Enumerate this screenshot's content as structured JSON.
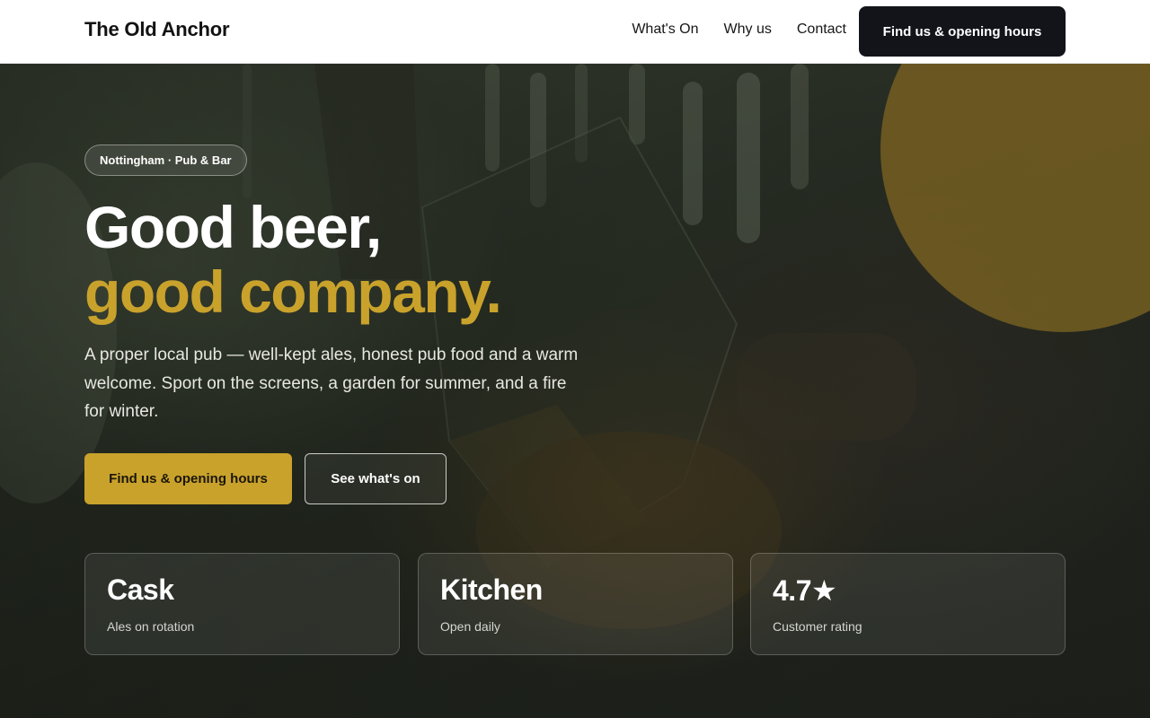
{
  "nav": {
    "brand": "The Old Anchor",
    "links": [
      "What's On",
      "Why us",
      "Contact"
    ],
    "cta": "Find us & opening hours"
  },
  "hero": {
    "pill": "Nottingham · Pub & Bar",
    "headline_line1": "Good beer,",
    "headline_line2": "good company.",
    "lead": "A proper local pub — well-kept ales, honest pub food and a warm welcome. Sport on the screens, a garden for summer, and a fire for winter.",
    "primary_button": "Find us & opening hours",
    "secondary_button": "See what's on"
  },
  "stats": [
    {
      "value": "Cask",
      "label": "Ales on rotation"
    },
    {
      "value": "Kitchen",
      "label": "Open daily"
    },
    {
      "value": "4.7★",
      "label": "Customer rating"
    }
  ],
  "colors": {
    "accent": "#c9a22c",
    "nav_cta_bg": "#12141a",
    "nav_bg": "#ffffff"
  }
}
